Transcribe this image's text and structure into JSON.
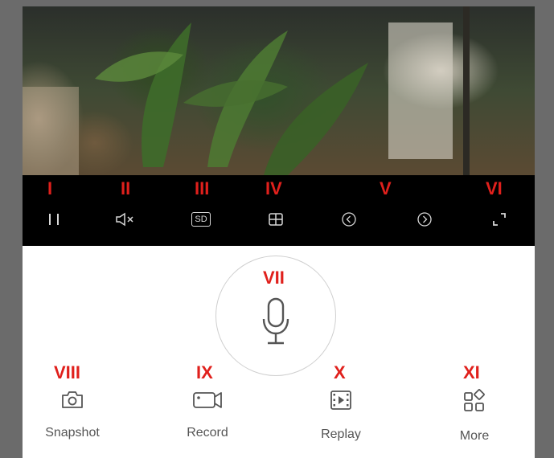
{
  "controls": {
    "pause": {
      "marker": "I",
      "icon": "pause-icon"
    },
    "mute": {
      "marker": "II",
      "icon": "speaker-muted-icon"
    },
    "quality": {
      "marker": "III",
      "label": "SD",
      "icon": "sd-quality-icon"
    },
    "layout": {
      "marker": "IV",
      "icon": "grid-icon"
    },
    "navigate": {
      "marker": "V",
      "icons": [
        "previous-icon",
        "next-icon"
      ]
    },
    "fullscreen": {
      "marker": "VI",
      "icon": "fullscreen-icon"
    }
  },
  "talk": {
    "marker": "VII",
    "icon": "microphone-icon"
  },
  "actions": [
    {
      "marker": "VIII",
      "label": "Snapshot",
      "icon": "camera-icon"
    },
    {
      "marker": "IX",
      "label": "Record",
      "icon": "video-camera-icon"
    },
    {
      "marker": "X",
      "label": "Replay",
      "icon": "replay-film-icon"
    },
    {
      "marker": "XI",
      "label": "More",
      "icon": "more-apps-icon"
    }
  ],
  "colors": {
    "marker": "#e0201c",
    "bar": "#000000",
    "icon": "#d8d8d8",
    "label": "#555555"
  }
}
